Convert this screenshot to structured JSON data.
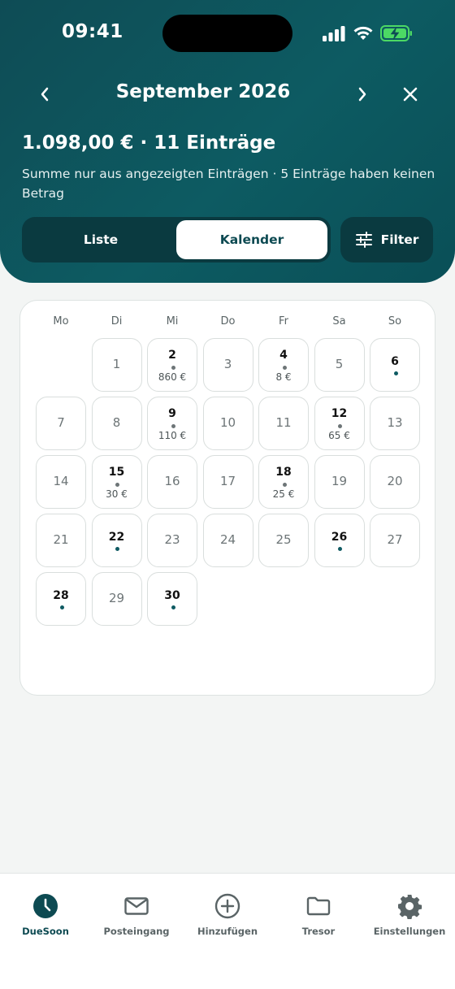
{
  "status_bar": {
    "time": "09:41"
  },
  "header": {
    "month": "September 2026",
    "summary": "1.098,00 € · 11 Einträge",
    "summary_sub": "Summe nur aus angezeigten Einträgen · 5 Einträge haben keinen Betrag"
  },
  "view_toggle": {
    "list_label": "Liste",
    "calendar_label": "Kalender",
    "selected": "Kalender"
  },
  "filter": {
    "label": "Filter"
  },
  "calendar": {
    "weekdays": [
      "Mo",
      "Di",
      "Mi",
      "Do",
      "Fr",
      "Sa",
      "So"
    ],
    "first_weekday_index": 1,
    "days": [
      {
        "day": "1"
      },
      {
        "day": "2",
        "amount": "860 €"
      },
      {
        "day": "3"
      },
      {
        "day": "4",
        "amount": "8 €"
      },
      {
        "day": "5"
      },
      {
        "day": "6",
        "marker": "teal"
      },
      {
        "day": "7"
      },
      {
        "day": "8"
      },
      {
        "day": "9",
        "amount": "110 €"
      },
      {
        "day": "10"
      },
      {
        "day": "11"
      },
      {
        "day": "12",
        "amount": "65 €"
      },
      {
        "day": "13"
      },
      {
        "day": "14"
      },
      {
        "day": "15",
        "amount": "30 €"
      },
      {
        "day": "16"
      },
      {
        "day": "17"
      },
      {
        "day": "18",
        "amount": "25 €"
      },
      {
        "day": "19"
      },
      {
        "day": "20"
      },
      {
        "day": "21"
      },
      {
        "day": "22",
        "marker": "teal"
      },
      {
        "day": "23"
      },
      {
        "day": "24"
      },
      {
        "day": "25"
      },
      {
        "day": "26",
        "marker": "teal"
      },
      {
        "day": "27"
      },
      {
        "day": "28",
        "marker": "teal"
      },
      {
        "day": "29"
      },
      {
        "day": "30",
        "marker": "teal"
      }
    ]
  },
  "tabbar": {
    "items": [
      {
        "label": "DueSoon",
        "icon": "clock-icon",
        "active": true
      },
      {
        "label": "Posteingang",
        "icon": "mail-icon"
      },
      {
        "label": "Hinzufügen",
        "icon": "plus-circle-icon"
      },
      {
        "label": "Tresor",
        "icon": "folder-icon"
      },
      {
        "label": "Einstellungen",
        "icon": "gear-icon"
      }
    ]
  },
  "colors": {
    "brand": "#0d4a52",
    "background": "#f3f5f4",
    "battery": "#4cd964"
  }
}
